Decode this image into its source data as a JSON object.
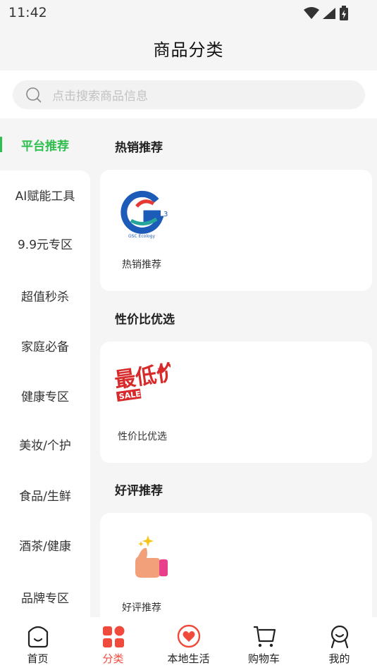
{
  "status_bar": {
    "time": "11:42"
  },
  "header": {
    "title": "商品分类"
  },
  "search": {
    "placeholder": "点击搜索商品信息"
  },
  "sidebar": {
    "active_label": "平台推荐",
    "items": [
      {
        "label": "AI赋能工具"
      },
      {
        "label": "9.9元专区"
      },
      {
        "label": "超值秒杀"
      },
      {
        "label": "家庭必备"
      },
      {
        "label": "健康专区"
      },
      {
        "label": "美妆/个护"
      },
      {
        "label": "食品/生鲜"
      },
      {
        "label": "酒茶/健康"
      },
      {
        "label": "品牌专区"
      }
    ]
  },
  "sections": [
    {
      "title": "热销推荐",
      "card_label": "热销推荐",
      "logo_text": "GSC Ecology"
    },
    {
      "title": "性价比优选",
      "card_label": "性价比优选",
      "badge_text": "最低价",
      "badge_sale": "SALE"
    },
    {
      "title": "好评推荐",
      "card_label": "好评推荐"
    }
  ],
  "tabbar": {
    "items": [
      {
        "label": "首页",
        "icon": "home-icon"
      },
      {
        "label": "分类",
        "icon": "category-icon"
      },
      {
        "label": "本地生活",
        "icon": "local-life-heart-icon"
      },
      {
        "label": "购物车",
        "icon": "cart-icon"
      },
      {
        "label": "我的",
        "icon": "profile-icon"
      }
    ],
    "active_color": "#f04a3c"
  },
  "colors": {
    "accent_green": "#2fbf4f",
    "accent_red": "#f04a3c"
  }
}
